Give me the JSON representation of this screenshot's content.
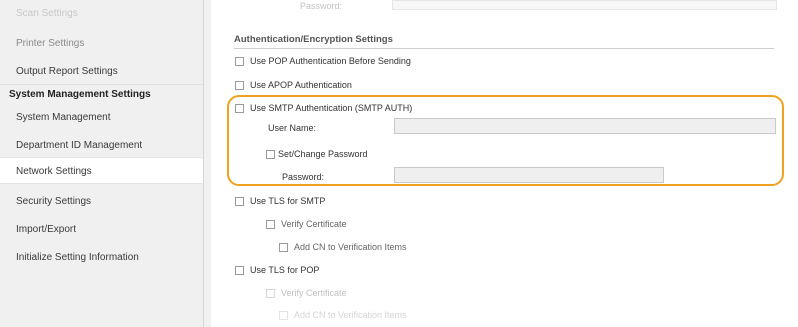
{
  "sidebar": {
    "items": [
      {
        "label": "Scan Settings"
      },
      {
        "label": "Printer Settings"
      },
      {
        "label": "Output Report Settings"
      }
    ],
    "group": "System Management Settings",
    "sub_items": [
      {
        "label": "System Management"
      },
      {
        "label": "Department ID Management"
      },
      {
        "label": "Network Settings"
      },
      {
        "label": "Security Settings"
      },
      {
        "label": "Import/Export"
      },
      {
        "label": "Initialize Setting Information"
      }
    ]
  },
  "main": {
    "top_label": "Password:",
    "section_title": "Authentication/Encryption Settings",
    "pop_before_sending": "Use POP Authentication Before Sending",
    "apop": "Use APOP Authentication",
    "smtp_auth": "Use SMTP Authentication (SMTP AUTH)",
    "user_name_label": "User Name:",
    "user_name_value": "",
    "set_change_password": "Set/Change Password",
    "password_label": "Password:",
    "password_value": "",
    "tls_smtp": "Use TLS for SMTP",
    "tls_smtp_verify": "Verify Certificate",
    "tls_smtp_add_cn": "Add CN to Verification Items",
    "tls_pop": "Use TLS for POP",
    "tls_pop_verify": "Verify Certificate",
    "tls_pop_add_cn": "Add CN to Verification Items"
  },
  "colors": {
    "highlight": "#f0a21e",
    "sidebar_bg": "#f0f0f0",
    "content_bg": "#ffffff"
  }
}
